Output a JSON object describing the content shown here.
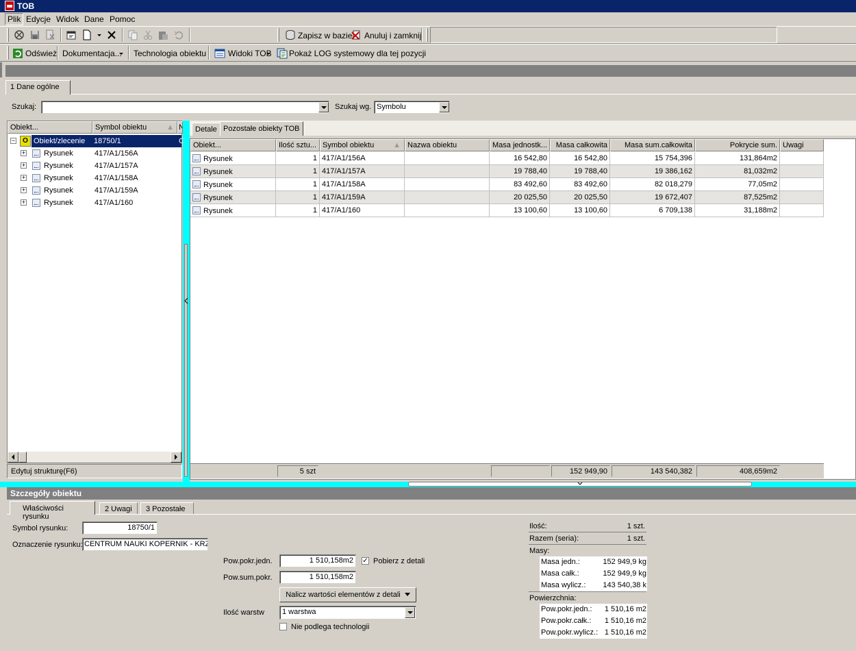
{
  "window": {
    "title": "TOB"
  },
  "menu": [
    "Plik",
    "Edycje",
    "Widok",
    "Dane",
    "Pomoc"
  ],
  "toolbar1": {
    "save_db": "Zapisz w bazie",
    "cancel_close": "Anuluj i zamknij"
  },
  "toolbar2": {
    "refresh": "Odśwież",
    "documentation": "Dokumentacja...",
    "technology": "Technologia obiektu",
    "views": "Widoki TOB",
    "log": "Pokaż LOG systemowy dla tej pozycji"
  },
  "main_tab": "1 Dane ogólne",
  "search": {
    "label": "Szukaj:",
    "value": "",
    "by_label": "Szukaj wg.",
    "by_value": "Symbolu"
  },
  "tree": {
    "col1": "Obiekt...",
    "col2": "Symbol obiektu",
    "col3": "N",
    "root": {
      "label": "Obiekt/zlecenie",
      "symbol": "18750/1",
      "extra": "C",
      "icon_letter": "O"
    },
    "items": [
      {
        "label": "Rysunek",
        "symbol": "417/A1/156A"
      },
      {
        "label": "Rysunek",
        "symbol": "417/A1/157A"
      },
      {
        "label": "Rysunek",
        "symbol": "417/A1/158A"
      },
      {
        "label": "Rysunek",
        "symbol": "417/A1/159A"
      },
      {
        "label": "Rysunek",
        "symbol": "417/A1/160"
      }
    ],
    "footer": "Edytuj strukturę(F6)"
  },
  "right_tabs": [
    "Detale",
    "Pozostałe obiekty TOB"
  ],
  "grid": {
    "headers": [
      "Obiekt...",
      "Ilość sztu...",
      "Symbol obiektu",
      "Nazwa obiektu",
      "Masa jednostk...",
      "Masa całkowita",
      "Masa sum.całkowita",
      "Pokrycie sum.",
      "Uwagi"
    ],
    "rows": [
      {
        "obj": "Rysunek",
        "qty": "1",
        "symbol": "417/A1/156A",
        "name": "",
        "unit_mass": "16 542,80",
        "total_mass": "16 542,80",
        "sum_mass": "15 754,396",
        "coverage": "131,864m2",
        "notes": ""
      },
      {
        "obj": "Rysunek",
        "qty": "1",
        "symbol": "417/A1/157A",
        "name": "",
        "unit_mass": "19 788,40",
        "total_mass": "19 788,40",
        "sum_mass": "19 386,162",
        "coverage": "81,032m2",
        "notes": ""
      },
      {
        "obj": "Rysunek",
        "qty": "1",
        "symbol": "417/A1/158A",
        "name": "",
        "unit_mass": "83 492,60",
        "total_mass": "83 492,60",
        "sum_mass": "82 018,279",
        "coverage": "77,05m2",
        "notes": ""
      },
      {
        "obj": "Rysunek",
        "qty": "1",
        "symbol": "417/A1/159A",
        "name": "",
        "unit_mass": "20 025,50",
        "total_mass": "20 025,50",
        "sum_mass": "19 672,407",
        "coverage": "87,525m2",
        "notes": ""
      },
      {
        "obj": "Rysunek",
        "qty": "1",
        "symbol": "417/A1/160",
        "name": "",
        "unit_mass": "13 100,60",
        "total_mass": "13 100,60",
        "sum_mass": "6 709,138",
        "coverage": "31,188m2",
        "notes": ""
      }
    ],
    "footer": {
      "qty": "5 szt",
      "unit_mass": "",
      "total_mass": "152 949,90",
      "sum_mass": "143 540,382",
      "coverage": "408,659m2"
    }
  },
  "details": {
    "title": "Szczegóły obiektu",
    "tabs": [
      "Właściwości rysunku",
      "2 Uwagi",
      "3 Pozostałe"
    ],
    "symbol_label": "Symbol rysunku:",
    "symbol_value": "18750/1",
    "designation_label": "Oznaczenie rysunku:",
    "designation_value": "CENTRUM NAUKI KOPERNIK - KRZYŻU",
    "pow_jedn_label": "Pow.pokr.jedn.",
    "pow_jedn_value": "1 510,158m2",
    "pobierz_label": "Pobierz z detali",
    "pobierz_checked": "✓",
    "pow_sum_label": "Pow.sum.pokr.",
    "pow_sum_value": "1 510,158m2",
    "calc_button": "Nalicz wartości elementów z detali",
    "layers_label": "Ilość warstw",
    "layers_value": "1 warstwa",
    "no_tech_label": "Nie podlega technologii"
  },
  "stats": {
    "qty_label": "Ilość:",
    "qty_value": "1 szt.",
    "total_label": "Razem (seria):",
    "total_value": "1 szt.",
    "masses_label": "Masy:",
    "mass_unit_label": "Masa jedn.:",
    "mass_unit_value": "152 949,9 kg",
    "mass_total_label": "Masa całk.:",
    "mass_total_value": "152 949,9 kg",
    "mass_calc_label": "Masa wylicz.:",
    "mass_calc_value": "143 540,38 k",
    "area_label": "Powierzchnia:",
    "area_unit_label": "Pow.pokr.jedn.:",
    "area_unit_value": "1 510,16 m2",
    "area_total_label": "Pow.pokr.całk.:",
    "area_total_value": "1 510,16 m2",
    "area_calc_label": "Pow.pokr.wylicz.:",
    "area_calc_value": "1 510,16 m2"
  }
}
